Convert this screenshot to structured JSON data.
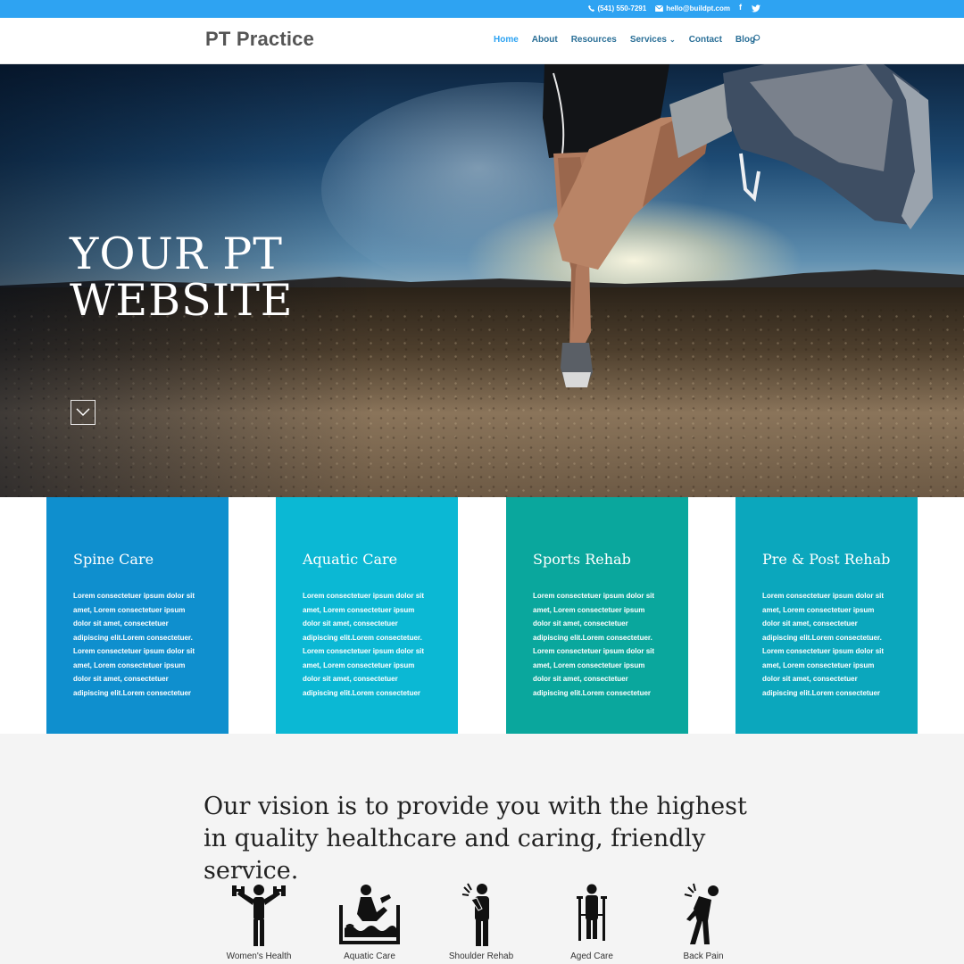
{
  "topbar": {
    "phone": "(541) 550-7291",
    "email": "hello@buildpt.com",
    "social": [
      "facebook-icon",
      "twitter-icon"
    ],
    "color": "#2ea3f2"
  },
  "header": {
    "logo": "PT Practice",
    "nav": [
      {
        "label": "Home",
        "active": true
      },
      {
        "label": "About"
      },
      {
        "label": "Resources"
      },
      {
        "label": "Services"
      },
      {
        "label": "Contact"
      },
      {
        "label": "Blog"
      }
    ],
    "search_icon": "search-icon"
  },
  "hero": {
    "title_line1": "YOUR PT",
    "title_line2": "WEBSITE",
    "scroll_icon": "chevron-down-icon"
  },
  "services": [
    {
      "title": "Spine Care",
      "text": "Lorem consectetuer ipsum dolor sit amet, Lorem consectetuer ipsum dolor sit amet, consectetuer adipiscing elit.Lorem consectetuer. Lorem consectetuer ipsum dolor sit amet, Lorem consectetuer ipsum dolor sit amet, consectetuer adipiscing elit.Lorem consectetuer",
      "color": "#0f8fce"
    },
    {
      "title": "Aquatic Care",
      "text": "Lorem consectetuer ipsum dolor sit amet, Lorem consectetuer ipsum dolor sit amet, consectetuer adipiscing elit.Lorem consectetuer. Lorem consectetuer ipsum dolor sit amet, Lorem consectetuer ipsum dolor sit amet, consectetuer adipiscing elit.Lorem consectetuer",
      "color": "#0bb8d4"
    },
    {
      "title": "Sports Rehab",
      "text": "Lorem consectetuer ipsum dolor sit amet, Lorem consectetuer ipsum dolor sit amet, consectetuer adipiscing elit.Lorem consectetuer. Lorem consectetuer ipsum dolor sit amet, Lorem consectetuer ipsum dolor sit amet, consectetuer adipiscing elit.Lorem consectetuer",
      "color": "#0aa79d"
    },
    {
      "title": "Pre & Post Rehab",
      "text": "Lorem consectetuer ipsum dolor sit amet, Lorem consectetuer ipsum dolor sit amet, consectetuer adipiscing elit.Lorem consectetuer. Lorem consectetuer ipsum dolor sit amet, Lorem consectetuer ipsum dolor sit amet, consectetuer adipiscing elit.Lorem consectetuer",
      "color": "#0ba7bd"
    }
  ],
  "vision": {
    "text": "Our vision is to provide you with the highest in quality healthcare and caring, friendly service."
  },
  "specialties": [
    {
      "label": "Women's Health",
      "icon": "weightlifting-icon"
    },
    {
      "label": "Aquatic Care",
      "icon": "aquatic-therapy-icon"
    },
    {
      "label": "Shoulder Rehab",
      "icon": "shoulder-pain-icon"
    },
    {
      "label": "Aged Care",
      "icon": "crutches-icon"
    },
    {
      "label": "Back Pain",
      "icon": "back-pain-icon"
    }
  ]
}
